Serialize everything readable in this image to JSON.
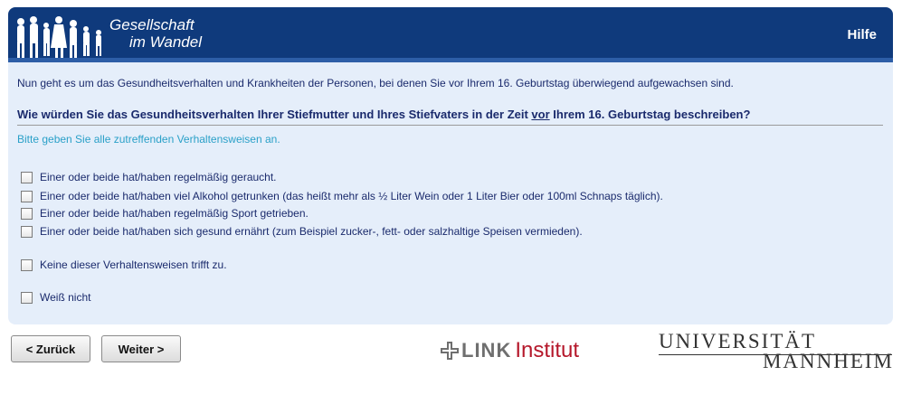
{
  "header": {
    "logo_line1": "Gesellschaft",
    "logo_line2": "im Wandel",
    "help_label": "Hilfe",
    "bg_color": "#0f3a7c"
  },
  "main": {
    "intro": "Nun geht es um das Gesundheitsverhalten und Krankheiten der Personen, bei denen Sie vor Ihrem 16. Geburtstag überwiegend aufgewachsen sind.",
    "question_pre": "Wie würden Sie das Gesundheitsverhalten Ihrer Stiefmutter und Ihres Stiefvaters in der Zeit ",
    "question_underlined": "vor",
    "question_post": " Ihrem 16. Geburtstag beschreiben?",
    "hint": "Bitte geben Sie alle zutreffenden Verhaltensweisen an.",
    "options": [
      {
        "label": "Einer oder beide hat/haben regelmäßig geraucht.",
        "checked": false
      },
      {
        "label": "Einer oder beide hat/haben viel Alkohol getrunken (das heißt mehr als ½ Liter Wein oder 1 Liter Bier oder 100ml Schnaps täglich).",
        "checked": false
      },
      {
        "label": "Einer oder beide hat/haben regelmäßig Sport getrieben.",
        "checked": false
      },
      {
        "label": "Einer oder beide hat/haben sich gesund ernährt (zum Beispiel zucker-, fett- oder salzhaltige Speisen vermieden).",
        "checked": false
      },
      {
        "label": "Keine dieser Verhaltensweisen trifft zu.",
        "checked": false
      },
      {
        "label": "Weiß nicht",
        "checked": false
      }
    ]
  },
  "nav": {
    "back_label": "< Zurück",
    "next_label": "Weiter >"
  },
  "footer": {
    "link_word": "LINK",
    "institut_word": "Institut",
    "uni_line1": "UNIVERSITÄT",
    "uni_line2": "MANNHEIM"
  }
}
